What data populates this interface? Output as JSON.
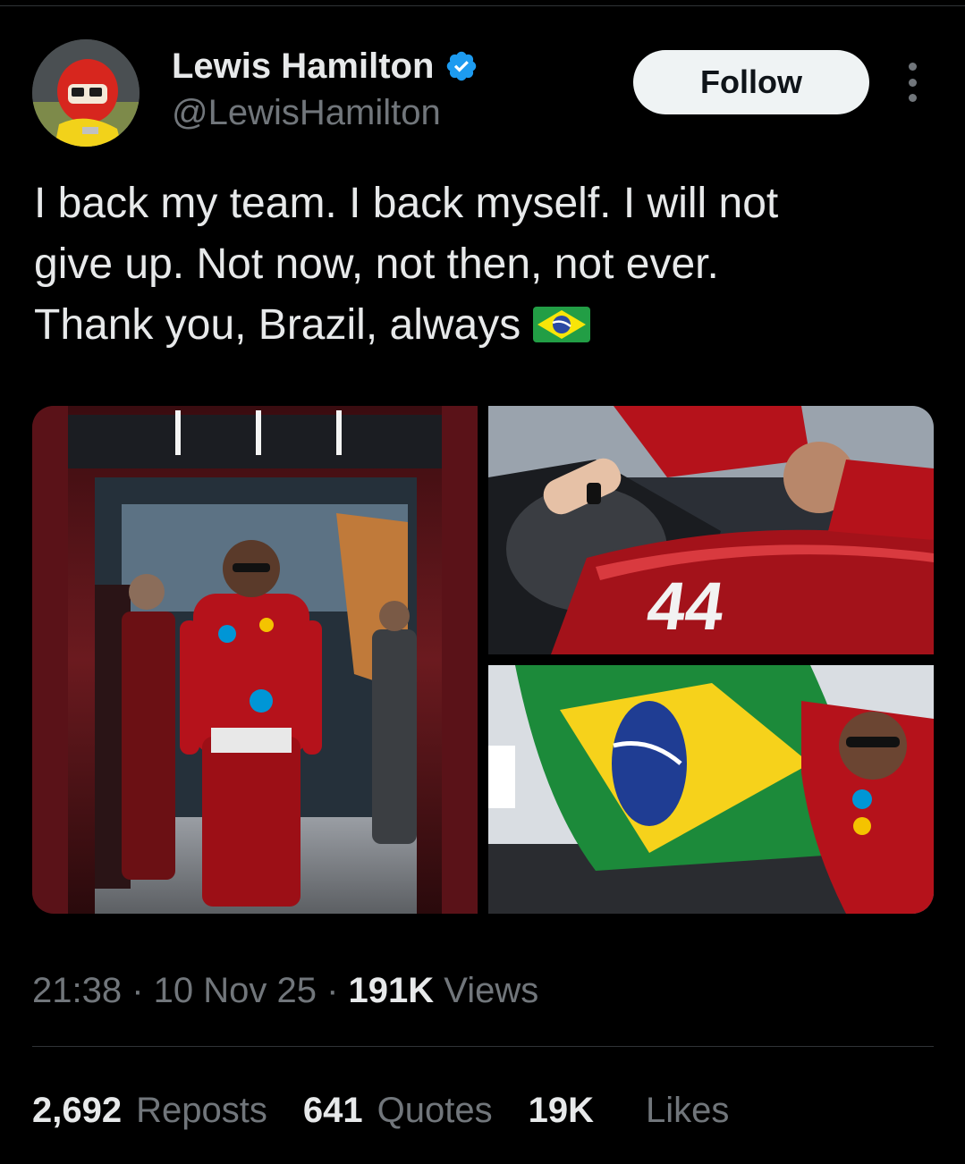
{
  "author": {
    "display_name": "Lewis Hamilton",
    "handle": "@LewisHamilton",
    "verified_icon": "verified-badge-icon",
    "verified_color": "#1d9bf0",
    "avatar_icon": "user-avatar"
  },
  "follow_button": {
    "label": "Follow"
  },
  "more_button": {
    "icon": "more-vertical-icon"
  },
  "tweet": {
    "lines": [
      "I back my team. I back myself. I will not",
      "give up. Not now, not then, not ever.",
      "Thank you, Brazil, always"
    ],
    "emoji": "flag-brazil-icon"
  },
  "media": {
    "images": [
      {
        "name": "driver-walking-in-garage-photo"
      },
      {
        "name": "mechanics-car-44-photo",
        "car_number": "44"
      },
      {
        "name": "driver-with-brazil-flag-photo"
      }
    ]
  },
  "meta": {
    "time": "21:38",
    "separator": " · ",
    "date": "10 Nov 25",
    "views_count": "191K",
    "views_label": "Views"
  },
  "stats": {
    "reposts_count": "2,692",
    "reposts_label": "Reposts",
    "quotes_count": "641",
    "quotes_label": "Quotes",
    "likes_count": "19K",
    "likes_label": "Likes"
  },
  "colors": {
    "background": "#000000",
    "text": "#e7e9ea",
    "secondary_text": "#71767b",
    "divider": "#2f3336",
    "follow_bg": "#eff3f4",
    "ferrari_red": "#b5121b"
  }
}
